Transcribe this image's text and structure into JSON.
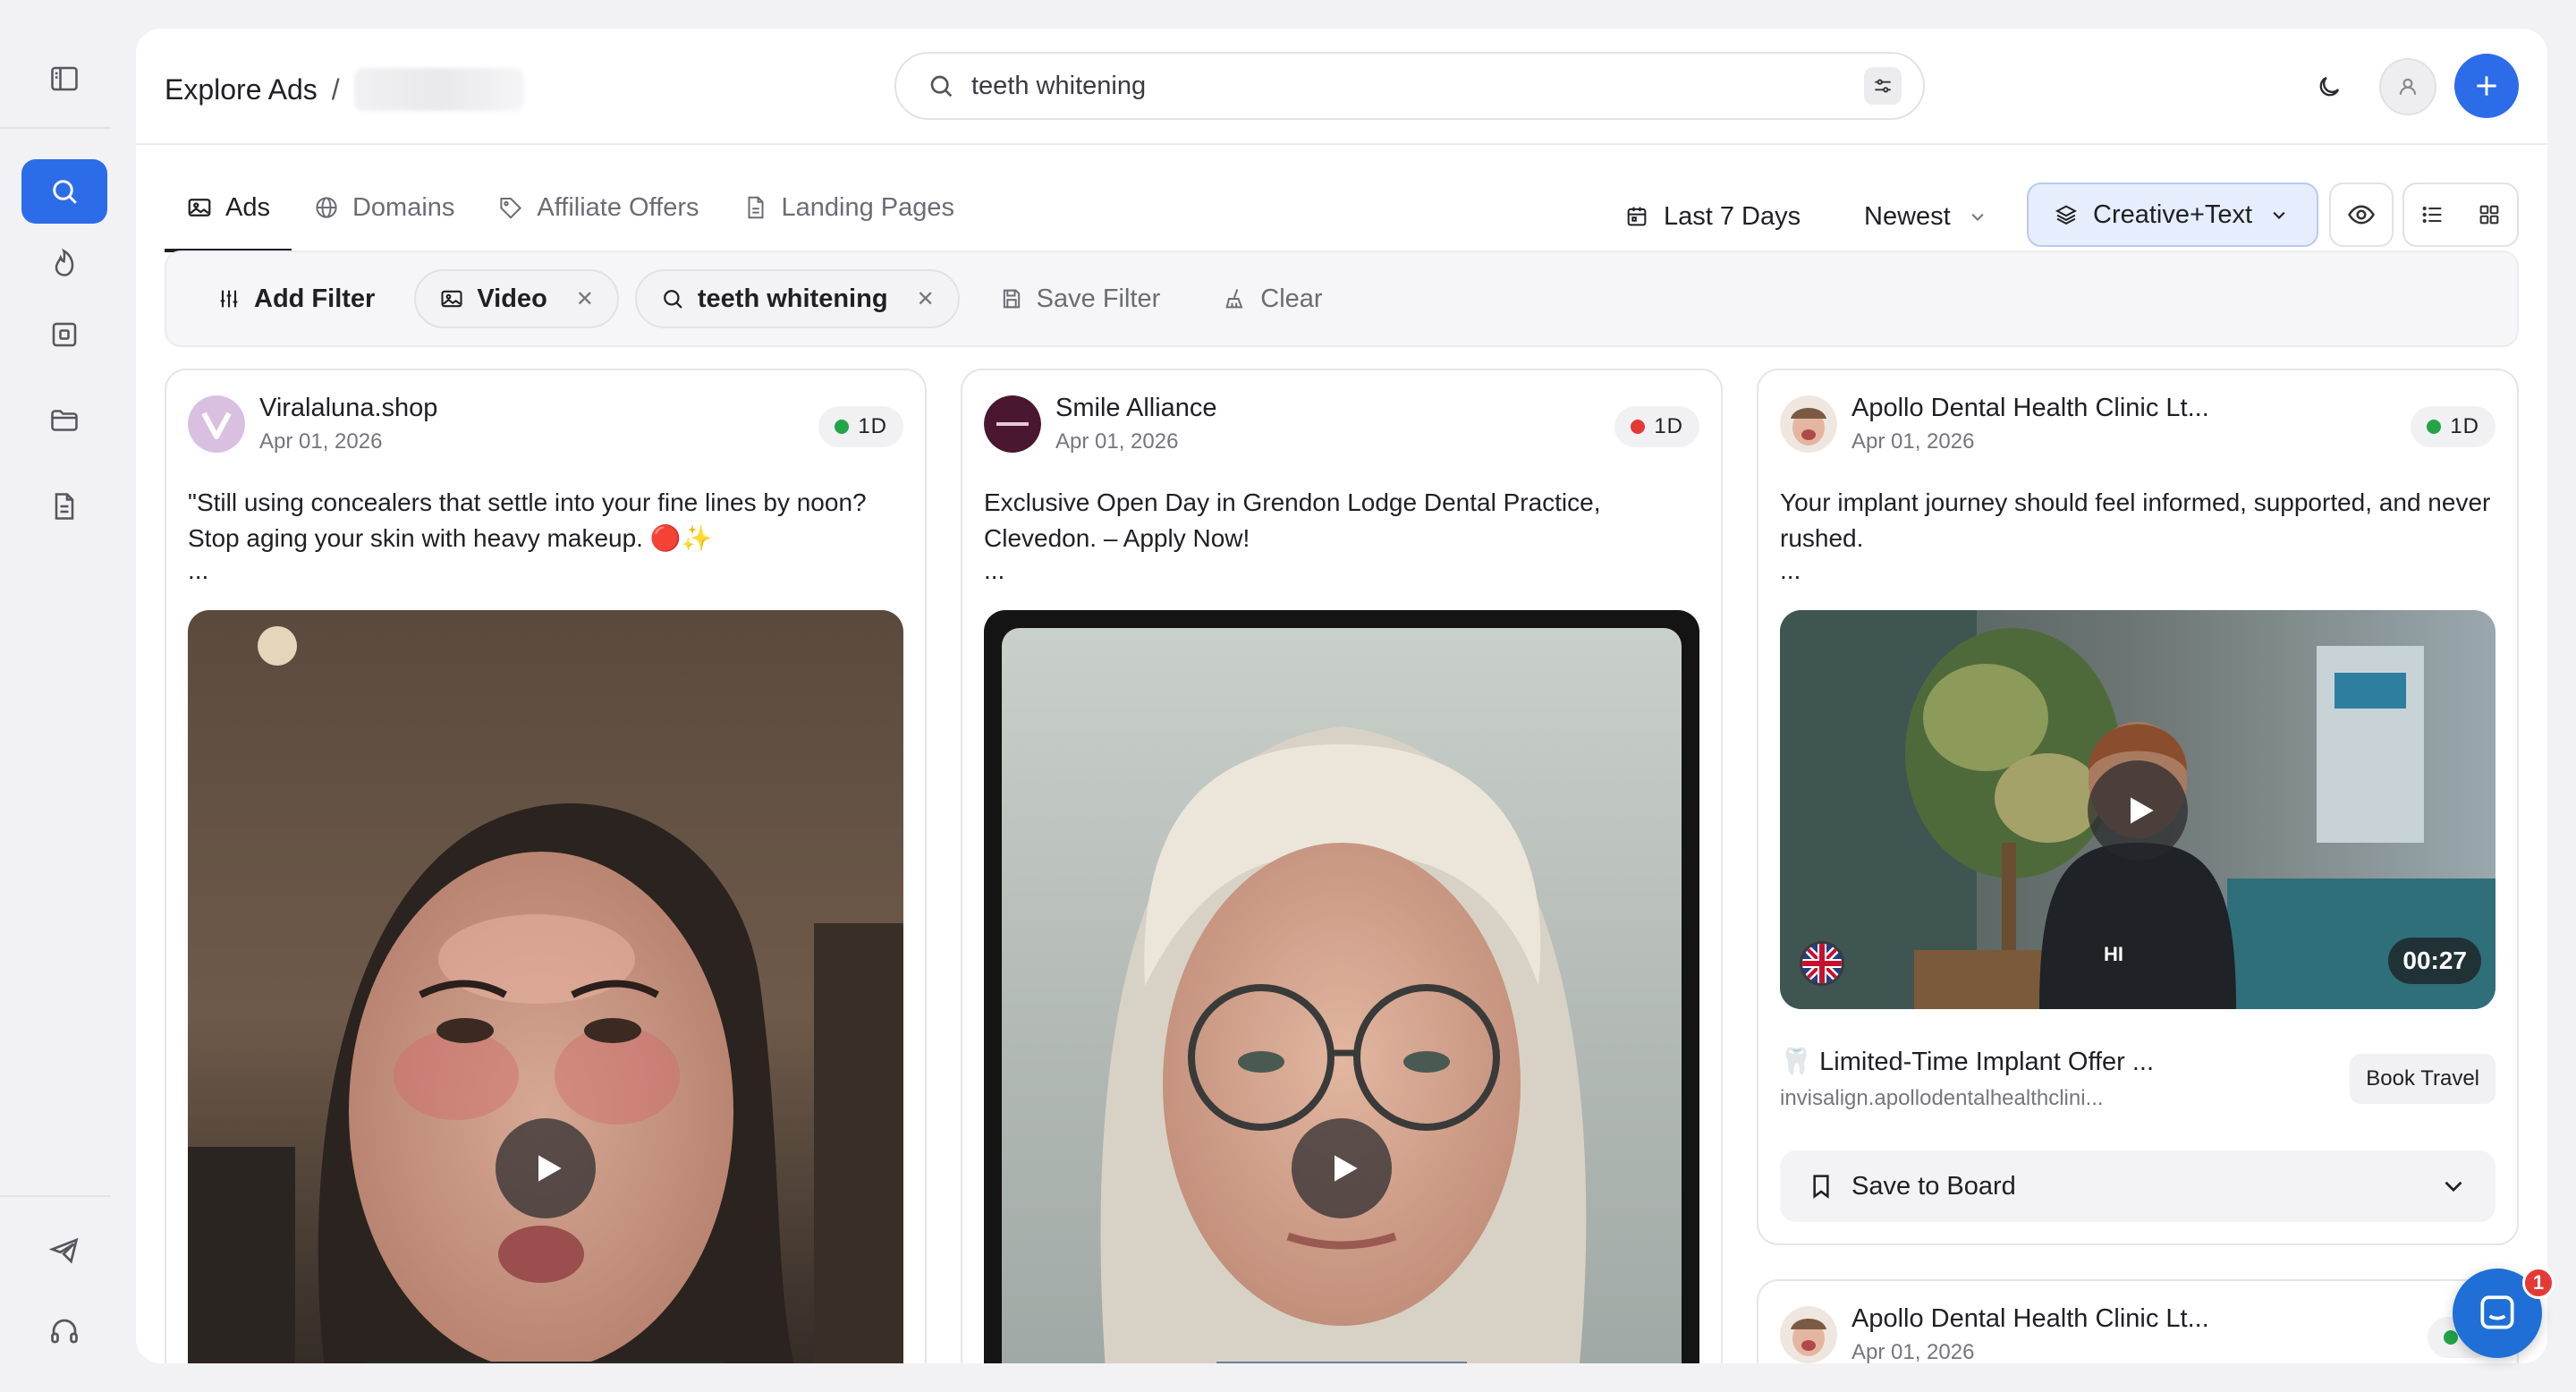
{
  "header": {
    "breadcrumb_root": "Explore Ads",
    "breadcrumb_sep": "/"
  },
  "search": {
    "value": "teeth whitening",
    "placeholder": ""
  },
  "tabs": [
    {
      "label": "Ads",
      "icon": "image-icon",
      "active": true
    },
    {
      "label": "Domains",
      "icon": "globe-icon"
    },
    {
      "label": "Affiliate Offers",
      "icon": "tag-icon"
    },
    {
      "label": "Landing Pages",
      "icon": "document-icon"
    }
  ],
  "controls": {
    "date_range": "Last 7 Days",
    "sort": "Newest",
    "display_mode": "Creative+Text"
  },
  "filters": {
    "add_filter": "Add Filter",
    "chips": [
      {
        "label": "Video",
        "icon": "image-icon"
      },
      {
        "label": "teeth whitening",
        "icon": "search-icon"
      }
    ],
    "save_filter": "Save Filter",
    "clear": "Clear"
  },
  "cards": [
    {
      "advertiser": "Viralaluna.shop",
      "date": "Apr 01, 2026",
      "badge": "1D",
      "status_color": "#22a447",
      "text": "\"Still using concealers that settle into your fine lines by noon? Stop aging your skin with heavy makeup. 🔴✨",
      "more": "..."
    },
    {
      "advertiser": "Smile Alliance",
      "date": "Apr 01, 2026",
      "badge": "1D",
      "status_color": "#e53935",
      "text": "Exclusive Open Day in Grendon Lodge Dental Practice, Clevedon. – Apply Now!",
      "more": "..."
    },
    {
      "advertiser": "Apollo Dental Health Clinic Lt...",
      "date": "Apr 01, 2026",
      "badge": "1D",
      "status_color": "#22a447",
      "text": "Your implant journey should feel informed, supported, and never rushed.",
      "more": "...",
      "video_caption": "HI",
      "duration": "00:27",
      "landing_title": "🦷 Limited-Time Implant Offer ...",
      "landing_url": "invisalign.apollodentalhealthclini...",
      "cta": "Book Travel",
      "save_label": "Save to Board"
    },
    {
      "advertiser": "Apollo Dental Health Clinic Lt...",
      "date": "Apr 01, 2026",
      "badge": "1",
      "status_color": "#22a447"
    }
  ],
  "chat": {
    "unread": "1"
  },
  "colors": {
    "accent": "#2d6ce9",
    "active_chip_bg": "#e6edfc"
  }
}
